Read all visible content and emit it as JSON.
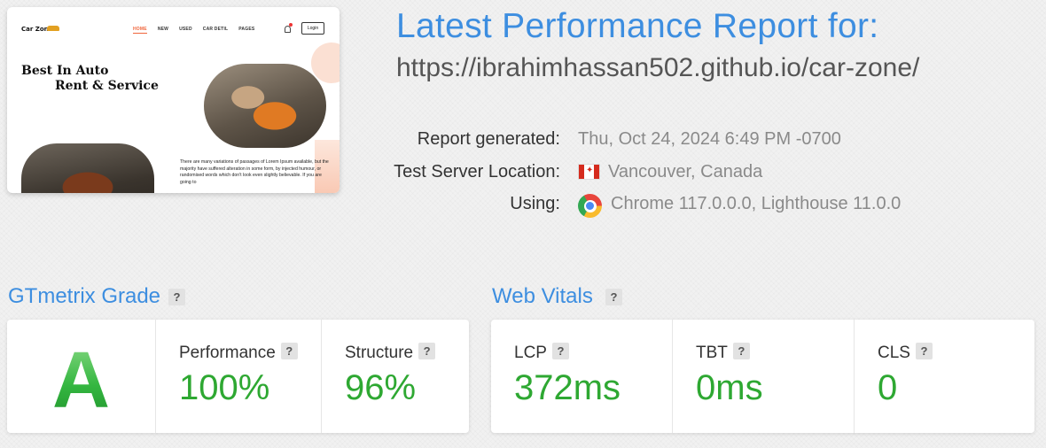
{
  "thumbnail": {
    "logo": "Car Zone",
    "nav": [
      "HOME",
      "NEW",
      "USED",
      "CAR DETIL",
      "PAGES"
    ],
    "login": "Login",
    "hero_line1": "Best In Auto",
    "hero_line2": "Rent & Service",
    "body": "There are many variations of passages of Lorem Ipsum available, but the majority have suffered alteration in some form, by injected humour, or randomised words which don't look even slightly believable. If you are going to"
  },
  "header": {
    "title": "Latest Performance Report for:",
    "url": "https://ibrahimhassan502.github.io/car-zone/"
  },
  "report": {
    "generated_label": "Report generated:",
    "generated_value": "Thu, Oct 24, 2024 6:49 PM -0700",
    "location_label": "Test Server Location:",
    "location_value": "Vancouver, Canada",
    "location_flag": "canada-flag-icon",
    "using_label": "Using:",
    "using_value": "Chrome 117.0.0.0, Lighthouse 11.0.0",
    "using_icon": "chrome-icon"
  },
  "gtmetrix": {
    "title": "GTmetrix Grade",
    "help": "?",
    "grade": "A",
    "performance_label": "Performance",
    "performance_value": "100%",
    "structure_label": "Structure",
    "structure_value": "96%"
  },
  "web_vitals": {
    "title": "Web Vitals",
    "help": "?",
    "lcp_label": "LCP",
    "lcp_value": "372ms",
    "tbt_label": "TBT",
    "tbt_value": "0ms",
    "cls_label": "CLS",
    "cls_value": "0"
  },
  "colors": {
    "accent_blue": "#3d8ee0",
    "good_green": "#2ea832"
  }
}
